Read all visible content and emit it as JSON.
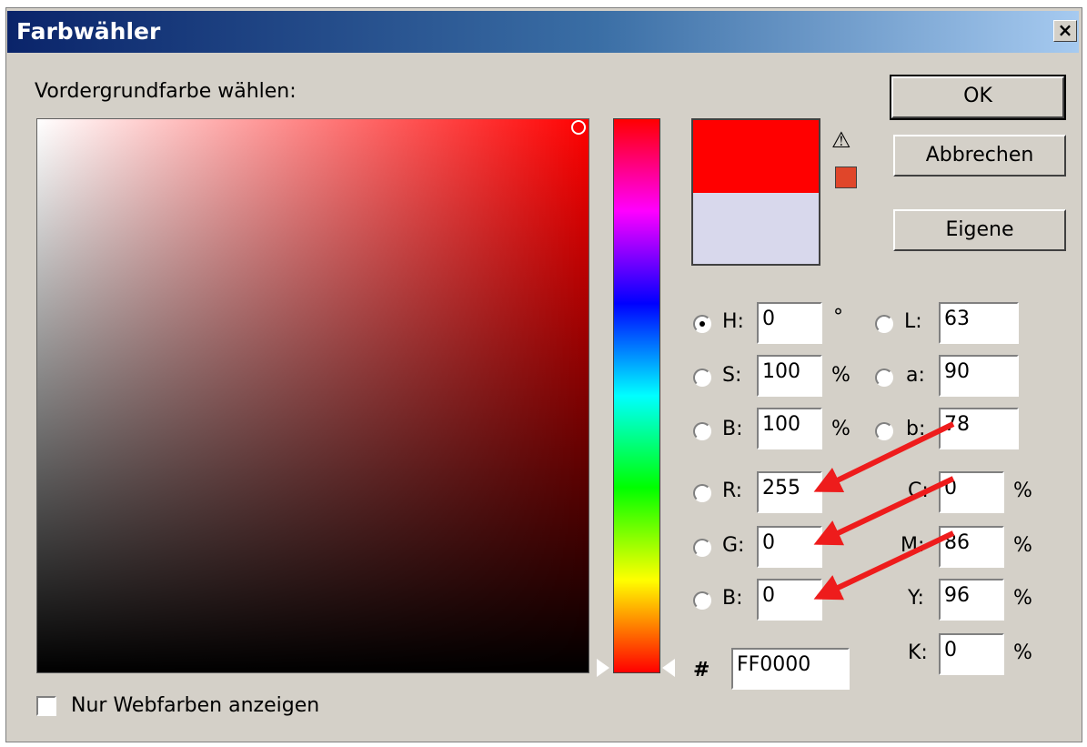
{
  "dialog": {
    "title": "Farbwähler",
    "close_label": "×",
    "prompt": "Vordergrundfarbe wählen:"
  },
  "buttons": {
    "ok": "OK",
    "cancel": "Abbrechen",
    "custom": "Eigene"
  },
  "colors": {
    "new_color": "#ff0000",
    "old_color": "#d8d8ec",
    "gamut_swatch": "#e0462a",
    "annotation_arrow": "#ee1c1c"
  },
  "icons": {
    "gamut_warning": "warning-triangle-icon"
  },
  "warning_glyph": "⚠",
  "hsb": [
    {
      "label": "H:",
      "value": "0",
      "unit": "°",
      "selected": true
    },
    {
      "label": "S:",
      "value": "100",
      "unit": "%",
      "selected": false
    },
    {
      "label": "B:",
      "value": "100",
      "unit": "%",
      "selected": false
    }
  ],
  "lab": [
    {
      "label": "L:",
      "value": "63",
      "selected": false
    },
    {
      "label": "a:",
      "value": "90",
      "selected": false
    },
    {
      "label": "b:",
      "value": "78",
      "selected": false
    }
  ],
  "rgb": [
    {
      "label": "R:",
      "value": "255",
      "selected": false
    },
    {
      "label": "G:",
      "value": "0",
      "selected": false
    },
    {
      "label": "B:",
      "value": "0",
      "selected": false
    }
  ],
  "cmyk": [
    {
      "label": "C:",
      "value": "0",
      "unit": "%"
    },
    {
      "label": "M:",
      "value": "86",
      "unit": "%"
    },
    {
      "label": "Y:",
      "value": "96",
      "unit": "%"
    },
    {
      "label": "K:",
      "value": "0",
      "unit": "%"
    }
  ],
  "hex": {
    "prefix": "#",
    "value": "FF0000"
  },
  "web_only": {
    "label": "Nur Webfarben anzeigen",
    "checked": false
  }
}
